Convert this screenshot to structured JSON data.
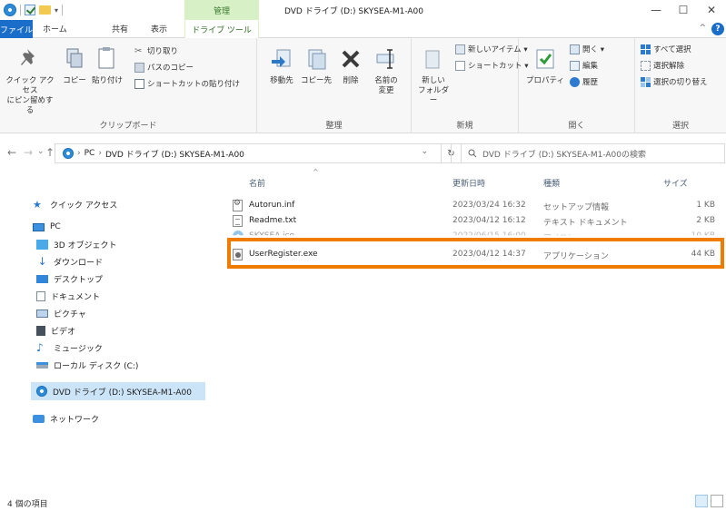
{
  "titlebar": {
    "manage_tab": "管理",
    "title": "DVD ドライブ (D:) SKYSEA-M1-A00",
    "minimize": "—",
    "maximize": "☐",
    "close": "✕"
  },
  "tabs": {
    "file": "ファイル",
    "home": "ホーム",
    "share": "共有",
    "view": "表示",
    "drive_tools": "ドライブ ツール",
    "help": "?",
    "collapse": "^"
  },
  "ribbon": {
    "clipboard": {
      "pin": "クイック アクセス\nにピン留めする",
      "copy": "コピー",
      "paste": "貼り付け",
      "cut": "切り取り",
      "copy_path": "パスのコピー",
      "paste_shortcut": "ショートカットの貼り付け",
      "label": "クリップボード"
    },
    "organize": {
      "move_to": "移動先",
      "copy_to": "コピー先",
      "delete": "削除",
      "rename": "名前の\n変更",
      "label": "整理"
    },
    "new": {
      "new_folder": "新しい\nフォルダー",
      "new_item": "新しいアイテム ▾",
      "shortcut": "ショートカット ▾",
      "label": "新規"
    },
    "open": {
      "properties": "プロパティ",
      "open": "開く ▾",
      "edit": "編集",
      "history": "履歴",
      "label": "開く"
    },
    "select": {
      "select_all": "すべて選択",
      "select_none": "選択解除",
      "invert": "選択の切り替え",
      "label": "選択"
    }
  },
  "address": {
    "back": "←",
    "forward": "→",
    "recent": "⌄",
    "up": "↑",
    "path": [
      "PC",
      "DVD ドライブ (D:) SKYSEA-M1-A00"
    ],
    "dropdown": "⌄",
    "refresh": "↻",
    "search_placeholder": "DVD ドライブ (D:) SKYSEA-M1-A00の検索"
  },
  "navpane": {
    "items": [
      {
        "label": "クイック アクセス"
      },
      {
        "label": "PC"
      },
      {
        "label": "3D オブジェクト"
      },
      {
        "label": "ダウンロード"
      },
      {
        "label": "デスクトップ"
      },
      {
        "label": "ドキュメント"
      },
      {
        "label": "ピクチャ"
      },
      {
        "label": "ビデオ"
      },
      {
        "label": "ミュージック"
      },
      {
        "label": "ローカル ディスク (C:)"
      },
      {
        "label": "DVD ドライブ (D:) SKYSEA-M1-A00"
      },
      {
        "label": "ネットワーク"
      }
    ]
  },
  "filelist": {
    "columns": {
      "name": "名前",
      "date": "更新日時",
      "type": "種類",
      "size": "サイズ"
    },
    "rows": [
      {
        "name": "Autorun.inf",
        "date": "2023/03/24 16:32",
        "type": "セットアップ情報",
        "size": "1 KB"
      },
      {
        "name": "Readme.txt",
        "date": "2023/04/12 16:12",
        "type": "テキスト ドキュメント",
        "size": "2 KB"
      },
      {
        "name": "SKYSEA.ico",
        "date": "2022/06/15 16:00",
        "type": "アイコン",
        "size": "10 KB"
      },
      {
        "name": "UserRegister.exe",
        "date": "2023/04/12 14:37",
        "type": "アプリケーション",
        "size": "44 KB"
      }
    ]
  },
  "status": {
    "count": "4 個の項目"
  },
  "colors": {
    "accent": "#1a6dc8",
    "manage": "#d7f0c6",
    "highlight": "#ef7c00",
    "selected": "#cce4f7"
  }
}
